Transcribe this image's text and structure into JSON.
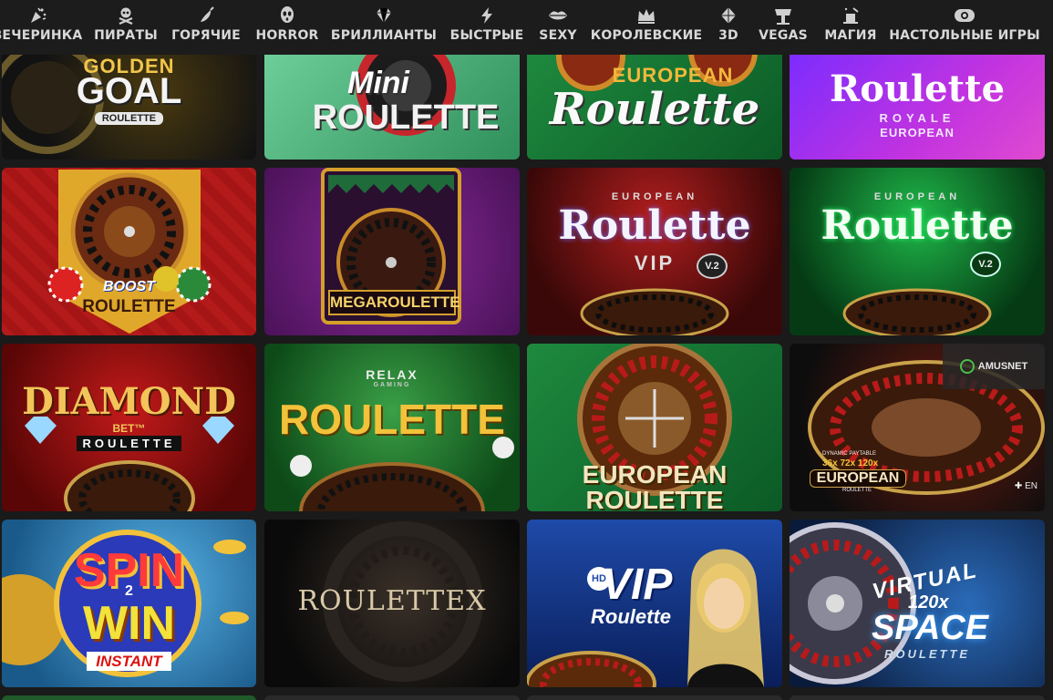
{
  "nav": [
    {
      "label": "ВЕЧЕРИНКА",
      "icon": "party-icon"
    },
    {
      "label": "ПИРАТЫ",
      "icon": "skull-crossbones-icon"
    },
    {
      "label": "ГОРЯЧИЕ",
      "icon": "chili-pepper-icon"
    },
    {
      "label": "HORROR",
      "icon": "ghost-mask-icon"
    },
    {
      "label": "БРИЛЛИАНТЫ",
      "icon": "diamond-icon"
    },
    {
      "label": "БЫСТРЫЕ",
      "icon": "lightning-icon"
    },
    {
      "label": "SEXY",
      "icon": "lips-icon"
    },
    {
      "label": "КОРОЛЕВСКИЕ",
      "icon": "crown-icon"
    },
    {
      "label": "3D",
      "icon": "gem-3d-icon"
    },
    {
      "label": "VEGAS",
      "icon": "vegas-sign-icon"
    },
    {
      "label": "МАГИЯ",
      "icon": "magic-hat-icon"
    },
    {
      "label": "НАСТОЛЬНЫЕ ИГРЫ",
      "icon": "chip-icon"
    }
  ],
  "tiles": [
    {
      "line1": "GOLDEN",
      "line2": "GOAL",
      "line3": "ROULETTE"
    },
    {
      "line1": "Mini",
      "line2": "ROULETTE"
    },
    {
      "line1": "EUROPEAN",
      "line2": "Roulette"
    },
    {
      "line1": "Roulette",
      "line2": "ROYALE",
      "line3": "EUROPEAN"
    },
    {
      "line1": "BOOST",
      "line2": "ROULETTE"
    },
    {
      "line1": "MEGAROULETTE"
    },
    {
      "line1": "EUROPEAN",
      "line2": "Roulette",
      "line3": "VIP",
      "badge": "V.2"
    },
    {
      "line1": "EUROPEAN",
      "line2": "Roulette",
      "badge": "V.2"
    },
    {
      "line1": "DIAMOND",
      "line2": "BET™",
      "line3": "ROULETTE"
    },
    {
      "line1": "RELAX",
      "line2": "GAMING",
      "line3": "ROULETTE"
    },
    {
      "line1": "EUROPEAN",
      "line2": "ROULETTE"
    },
    {
      "line1": "DYNAMIC PAYTABLE",
      "line2": "36x 72x 120x",
      "line3": "EUROPEAN",
      "line4": "ROULETTE",
      "provider": "AMUSNET",
      "lang": "EN"
    },
    {
      "line1": "SPIN",
      "line2": "2",
      "line3": "WIN",
      "line4": "INSTANT"
    },
    {
      "line1": "ROULETTEX"
    },
    {
      "line1": "HD",
      "line2": "VIP",
      "line3": "Roulette"
    },
    {
      "line1": "VIRTUAL",
      "line2": "120x",
      "line3": "SPACE",
      "line4": "ROULETTE"
    }
  ],
  "colors": {
    "nav_bg": "#1c1c1c",
    "nav_text": "#d8d8d8",
    "page_bg": "#1a1a1a"
  }
}
